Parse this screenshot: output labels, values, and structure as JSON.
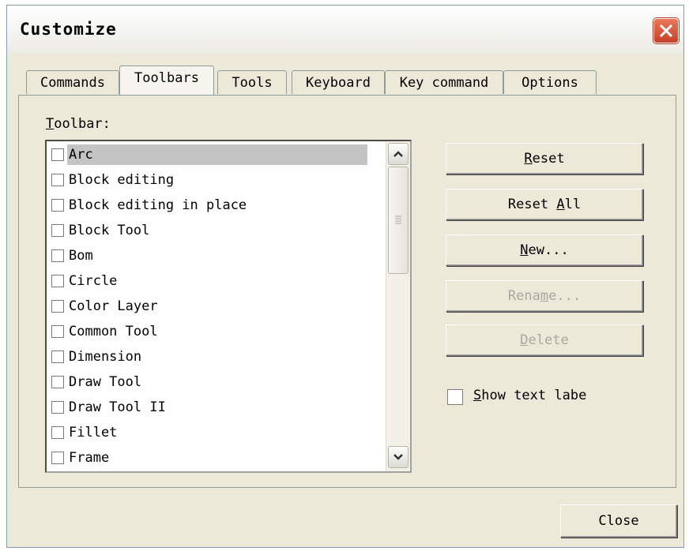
{
  "window": {
    "title": "Customize"
  },
  "tabs": [
    {
      "label": "Commands",
      "active": false
    },
    {
      "label": "Toolbars",
      "active": true
    },
    {
      "label": "Tools",
      "active": false
    },
    {
      "label": "Keyboard",
      "active": false
    },
    {
      "label": "Key command",
      "active": false
    },
    {
      "label": "Options",
      "active": false
    }
  ],
  "toolbars_section": {
    "label_underlined": "T",
    "label_rest": "oolbar:",
    "items": [
      {
        "label": "Arc",
        "checked": false,
        "selected": true
      },
      {
        "label": "Block editing",
        "checked": false
      },
      {
        "label": "Block editing in place",
        "checked": false
      },
      {
        "label": "Block Tool",
        "checked": false
      },
      {
        "label": "Bom",
        "checked": false
      },
      {
        "label": "Circle",
        "checked": false
      },
      {
        "label": "Color Layer",
        "checked": false
      },
      {
        "label": "Common Tool",
        "checked": false
      },
      {
        "label": "Dimension",
        "checked": false
      },
      {
        "label": "Draw Tool",
        "checked": false
      },
      {
        "label": "Draw Tool II",
        "checked": false
      },
      {
        "label": "Fillet",
        "checked": false
      },
      {
        "label": "Frame",
        "checked": false
      }
    ]
  },
  "buttons": {
    "reset": {
      "ul": "R",
      "rest": "eset",
      "enabled": true
    },
    "reset_all": {
      "pre": "Reset ",
      "ul": "A",
      "rest": "ll",
      "enabled": true
    },
    "new": {
      "ul": "N",
      "rest": "ew...",
      "enabled": true
    },
    "rename": {
      "pre": "Rena",
      "ul": "m",
      "rest": "e...",
      "enabled": false
    },
    "delete": {
      "ul": "D",
      "rest": "elete",
      "enabled": false
    }
  },
  "show_text_labels": {
    "ul": "S",
    "rest": "how text labe",
    "checked": false
  },
  "close_button": {
    "label": "Close"
  },
  "colors": {
    "dialog_bg": "#ece9d8",
    "close_red": "#c7402a",
    "selection": "#c4c4c4"
  }
}
